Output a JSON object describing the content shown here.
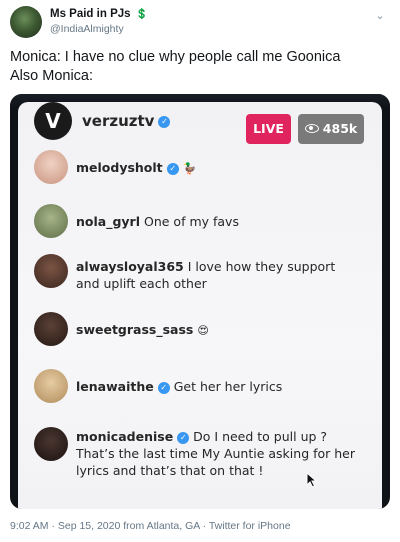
{
  "tweet": {
    "display_name": "Ms Paid in PJs",
    "money_emoji": "💲",
    "handle": "@IndiaAlmighty",
    "text_line1": "Monica: I have no clue why people call me Goonica",
    "text_line2": "Also Monica:",
    "footer": "9:02 AM · Sep 15, 2020 from Atlanta, GA · Twitter for iPhone"
  },
  "live": {
    "host": "verzuztv",
    "avatar_letter": "V",
    "live_label": "LIVE",
    "viewers": "485k"
  },
  "comments": [
    {
      "user": "melodysholt",
      "verified": true,
      "text": "",
      "emoji": "🦆",
      "avatar_color": "#e3b8a8"
    },
    {
      "user": "nola_gyrl",
      "verified": false,
      "text": "One of my favs",
      "emoji": "",
      "avatar_color": "#8b9a6c"
    },
    {
      "user": "alwaysloyal365",
      "verified": false,
      "text": "I love how they support and uplift each other",
      "emoji": "",
      "avatar_color": "#5a3b2e"
    },
    {
      "user": "sweetgrass_sass",
      "verified": false,
      "text": "",
      "emoji": "😍",
      "avatar_color": "#3d2b24"
    },
    {
      "user": "lenawaithe",
      "verified": true,
      "text": "Get her her lyrics",
      "emoji": "",
      "avatar_color": "#c9a77c"
    },
    {
      "user": "monicadenise",
      "verified": true,
      "text": "Do I need to pull up ? That’s the last time My Auntie asking for her lyrics and that’s that on that !",
      "emoji": "",
      "avatar_color": "#2a1f1c"
    }
  ]
}
